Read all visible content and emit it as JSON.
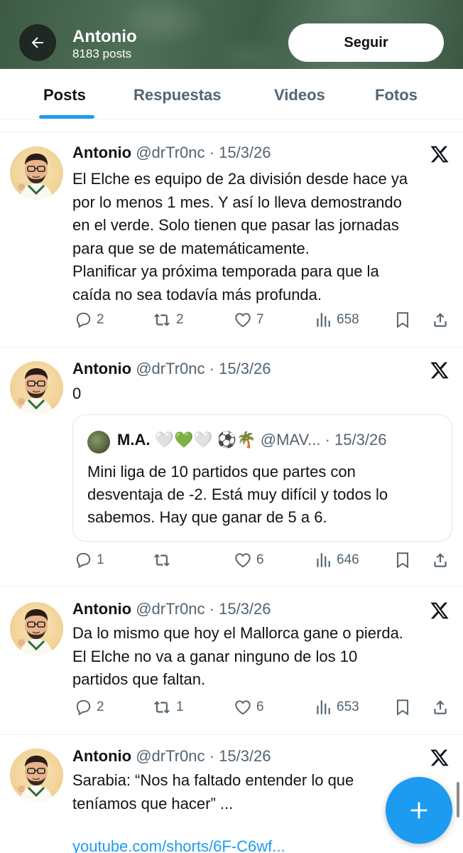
{
  "header": {
    "name": "Antonio",
    "posts_count": "8183 posts",
    "follow_label": "Seguir"
  },
  "tabs": [
    {
      "label": "Posts",
      "active": true
    },
    {
      "label": "Respuestas",
      "active": false
    },
    {
      "label": "Videos",
      "active": false
    },
    {
      "label": "Fotos",
      "active": false
    }
  ],
  "tweets": [
    {
      "author": "Antonio",
      "handle": "@drTr0nc",
      "date": "15/3/26",
      "text_lines": [
        "El Elche es equipo de 2a división desde hace ya",
        "por lo menos 1 mes. Y así lo lleva demostrando",
        "en el verde. Solo tienen que pasar las jornadas",
        "para que se de matemáticamente.",
        "Planificar ya próxima temporada para que la",
        "caída no sea todavía más profunda."
      ],
      "replies": "2",
      "reposts": "2",
      "likes": "7",
      "views": "658"
    },
    {
      "author": "Antonio",
      "handle": "@drTr0nc",
      "date": "15/3/26",
      "text_lines": [
        "0"
      ],
      "quote": {
        "author": "M.A. 🤍💚🤍 ⚽🌴",
        "handle": "@MAV...",
        "date": "15/3/26",
        "text_lines": [
          "Mini liga de 10 partidos que partes con",
          "desventaja de -2. Está muy difícil y todos lo",
          "sabemos. Hay que ganar de 5 a 6."
        ]
      },
      "replies": "1",
      "reposts": "",
      "likes": "6",
      "views": "646"
    },
    {
      "author": "Antonio",
      "handle": "@drTr0nc",
      "date": "15/3/26",
      "text_lines": [
        "Da lo mismo que hoy el Mallorca gane o pierda.",
        "El Elche no va a ganar ninguno de los 10",
        "partidos que faltan."
      ],
      "replies": "2",
      "reposts": "1",
      "likes": "6",
      "views": "653"
    },
    {
      "author": "Antonio",
      "handle": "@drTr0nc",
      "date": "15/3/26",
      "text_lines": [
        "Sarabia: “Nos ha faltado entender lo que",
        "teníamos que hacer” ..."
      ],
      "link": "youtube.com/shorts/6F-C6wf..."
    }
  ],
  "sep": " · ",
  "icons": {
    "back": "arrow-left-icon",
    "x": "x-logo-icon",
    "reply": "reply-icon",
    "repost": "repost-icon",
    "like": "heart-icon",
    "views": "views-icon",
    "bookmark": "bookmark-icon",
    "share": "share-icon",
    "compose": "plus-icon"
  },
  "colors": {
    "accent": "#1d9bf0",
    "text": "#0f1419",
    "muted": "#536471"
  }
}
